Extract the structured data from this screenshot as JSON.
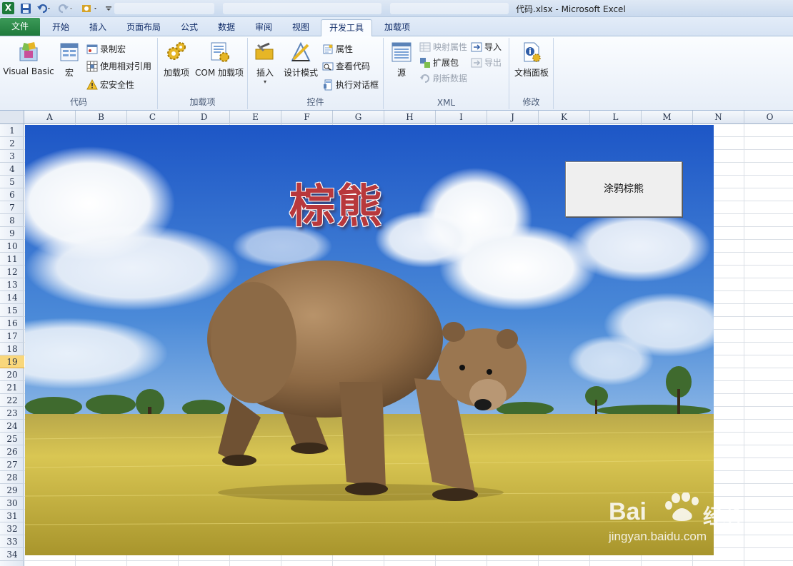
{
  "window": {
    "title": "代码.xlsx  -  Microsoft Excel",
    "ghost_tabs": [
      "",
      "",
      ""
    ]
  },
  "ribbon": {
    "tabs": [
      {
        "label": "文件",
        "key": "file"
      },
      {
        "label": "开始",
        "key": "home"
      },
      {
        "label": "插入",
        "key": "insert"
      },
      {
        "label": "页面布局",
        "key": "layout"
      },
      {
        "label": "公式",
        "key": "formulas"
      },
      {
        "label": "数据",
        "key": "data"
      },
      {
        "label": "审阅",
        "key": "review"
      },
      {
        "label": "视图",
        "key": "view"
      },
      {
        "label": "开发工具",
        "key": "developer",
        "active": true
      },
      {
        "label": "加载项",
        "key": "addins"
      }
    ],
    "groups": {
      "code": {
        "label": "代码",
        "visual_basic": "Visual Basic",
        "macros": "宏",
        "record_macro": "录制宏",
        "relative_refs": "使用相对引用",
        "macro_security": "宏安全性"
      },
      "addins": {
        "label": "加载项",
        "addins": "加载项",
        "com_addins": "COM 加载项"
      },
      "controls": {
        "label": "控件",
        "insert": "插入",
        "design_mode": "设计模式",
        "properties": "属性",
        "view_code": "查看代码",
        "run_dialog": "执行对话框"
      },
      "xml": {
        "label": "XML",
        "source": "源",
        "map_properties": "映射属性",
        "expansion_packs": "扩展包",
        "refresh_data": "刷新数据",
        "import": "导入",
        "export": "导出"
      },
      "modify": {
        "label": "修改",
        "document_panel": "文档面板"
      }
    }
  },
  "sheet": {
    "columns": [
      "A",
      "B",
      "C",
      "D",
      "E",
      "F",
      "G",
      "H",
      "I",
      "J",
      "K",
      "L",
      "M",
      "N",
      "O"
    ],
    "rows": [
      "1",
      "2",
      "3",
      "4",
      "5",
      "6",
      "7",
      "8",
      "9",
      "10",
      "11",
      "12",
      "13",
      "14",
      "15",
      "16",
      "17",
      "18",
      "19",
      "20",
      "21",
      "22",
      "23",
      "24",
      "25",
      "26",
      "27",
      "28",
      "29",
      "30",
      "31",
      "32",
      "33",
      "34"
    ],
    "selected_row": "19",
    "picture_title": "棕熊",
    "macro_button": "涂鸦棕熊"
  },
  "watermark": {
    "brand": "Bai",
    "brand_cn": "经验",
    "url": "jingyan.baidu.com"
  },
  "colors": {
    "file_tab": "#1f7a3c",
    "title_text": "#b8383c",
    "selected_row_header": "#f9d77b"
  }
}
